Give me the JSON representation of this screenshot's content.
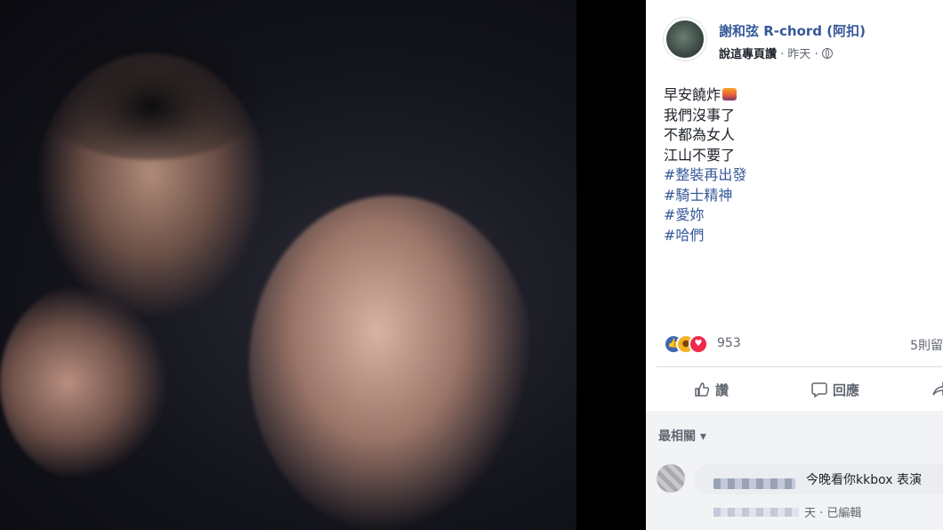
{
  "post": {
    "page_name": "謝和弦 R-chord (阿扣)",
    "meta_prefix": "說這專頁讚",
    "separator": " · ",
    "time": "昨天",
    "privacy_icon": "globe-icon",
    "lines": [
      "早安饒炸",
      "我們沒事了",
      "不都為女人",
      "江山不要了"
    ],
    "sun_emoji": "sunrise-emoji",
    "hashtags": [
      "#整裝再出發",
      "#騎士精神",
      "#愛妳",
      "#哈們"
    ]
  },
  "reactions": {
    "icons": [
      "like-reaction-icon",
      "wow-reaction-icon",
      "love-reaction-icon"
    ],
    "count": "953",
    "shares": "5則留"
  },
  "actions": {
    "like": "讚",
    "comment": "回應"
  },
  "comments": {
    "sort_label": "最相關",
    "items": [
      {
        "text": "今晚看你kkbox 表演",
        "meta_suffix": "天 · 已編輯"
      }
    ]
  },
  "colors": {
    "link": "#365899",
    "meta": "#616770",
    "like_blue": "#4267b2",
    "love_red": "#f0284a",
    "wow_yellow": "#f7b125",
    "comment_bg": "#f2f3f5"
  }
}
